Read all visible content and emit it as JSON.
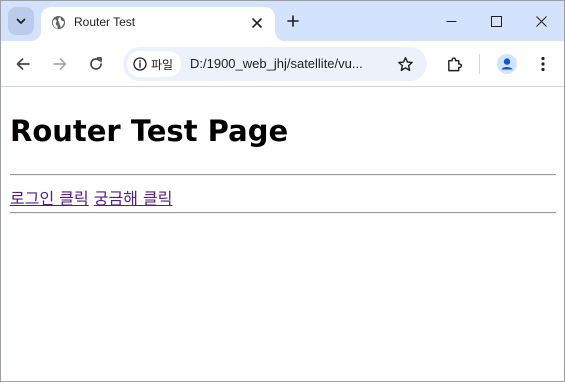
{
  "tab": {
    "title": "Router Test",
    "favicon": "globe-icon"
  },
  "address_bar": {
    "site_chip_label": "파일",
    "url": "D:/1900_web_jhj/satellite/vu..."
  },
  "page": {
    "heading": "Router Test Page",
    "links": [
      {
        "label": "로그인 클릭"
      },
      {
        "label": "궁금해 클릭"
      }
    ]
  },
  "colors": {
    "tabstrip_bg": "#d3e3fd",
    "omnibox_bg": "#edf2fa",
    "visited_link": "#551a8b",
    "profile_accent": "#0b57d0"
  }
}
